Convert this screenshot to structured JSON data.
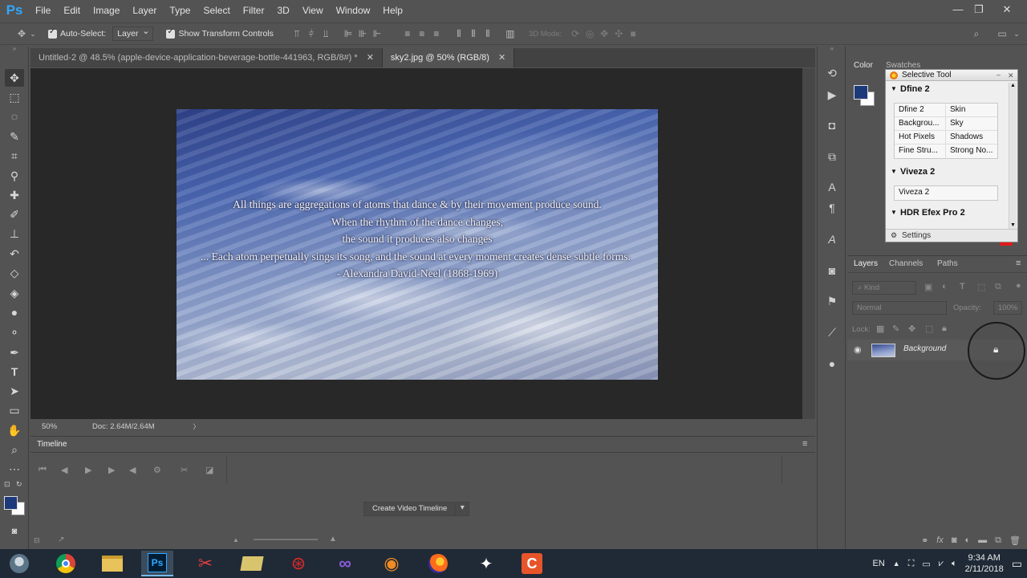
{
  "app": {
    "logo": "Ps"
  },
  "menu": [
    "File",
    "Edit",
    "Image",
    "Layer",
    "Type",
    "Select",
    "Filter",
    "3D",
    "View",
    "Window",
    "Help"
  ],
  "window_controls": {
    "minimize": "—",
    "restore": "❐",
    "close": "✕"
  },
  "options": {
    "auto_select_label": "Auto-Select:",
    "auto_select_value": "Layer",
    "show_transform_label": "Show Transform Controls",
    "mode_3d_label": "3D Mode:"
  },
  "tabs": [
    {
      "label": "Untitled-2 @ 48.5% (apple-device-application-beverage-bottle-441963, RGB/8#) *",
      "close": "✕"
    },
    {
      "label": "sky2.jpg @ 50% (RGB/8)",
      "close": "✕"
    }
  ],
  "quote": {
    "line1": "All things are aggregations of atoms that dance & by their movement produce sound.",
    "line2": "When the rhythm of the dance changes,",
    "line3": "the sound it produces also changes",
    "line4": "... Each atom perpetually sings its song, and the sound at every moment creates dense subtle forms.",
    "line5": "- Alexandra David-Neel (1868-1969)"
  },
  "status": {
    "zoom": "50%",
    "doc": "Doc: 2.64M/2.64M",
    "arrow": "〉"
  },
  "timeline": {
    "title": "Timeline",
    "create_button": "Create Video Timeline",
    "create_arrow": "▾"
  },
  "color_panel": {
    "tab_color": "Color",
    "tab_swatches": "Swatches",
    "fg_color": "#1c3a7a",
    "bg_color": "#ffffff"
  },
  "selective_tool": {
    "title": "Selective Tool",
    "sections": [
      {
        "name": "Dfine 2",
        "rows": [
          [
            "Dfine 2",
            "Skin"
          ],
          [
            "Backgrou...",
            "Sky"
          ],
          [
            "Hot Pixels",
            "Shadows"
          ],
          [
            "Fine Stru...",
            "Strong No..."
          ]
        ]
      },
      {
        "name": "Viveza 2",
        "rows": [
          [
            "Viveza 2"
          ]
        ]
      },
      {
        "name": "HDR Efex Pro 2",
        "rows": []
      }
    ],
    "settings": "Settings"
  },
  "layers_panel": {
    "tabs": [
      "Layers",
      "Channels",
      "Paths"
    ],
    "kind_placeholder": "Kind",
    "blend_mode": "Normal",
    "opacity_label": "Opacity:",
    "opacity_value": "100%",
    "lock_label": "Lock:",
    "layers": [
      {
        "name": "Background"
      }
    ]
  },
  "taskbar": {
    "lang": "EN",
    "time": "9:34 AM",
    "date": "2/11/2018"
  }
}
